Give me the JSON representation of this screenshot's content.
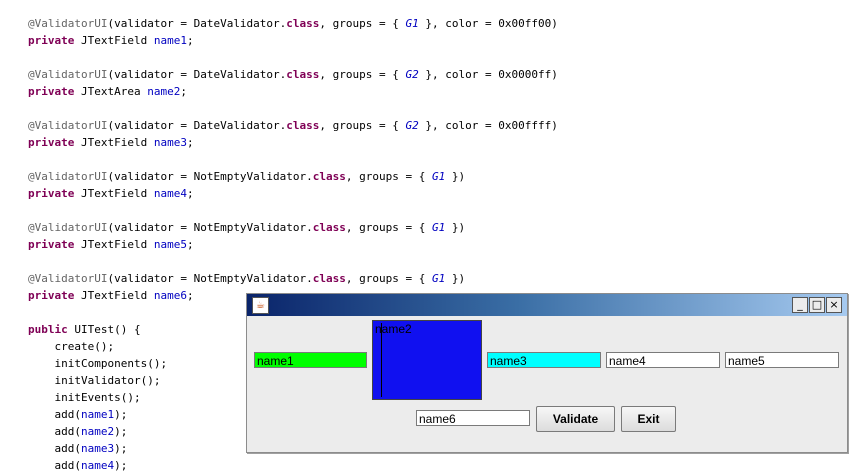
{
  "code_lines": [
    [
      {
        "t": "@ValidatorUI",
        "c": "ann"
      },
      {
        "t": "(validator = DateValidator."
      },
      {
        "t": "class",
        "c": "kw"
      },
      {
        "t": ", groups = { "
      },
      {
        "t": "G1",
        "c": "grp"
      },
      {
        "t": " }, color = 0x00ff00)"
      }
    ],
    [
      {
        "t": "private",
        "c": "kw"
      },
      {
        "t": " JTextField "
      },
      {
        "t": "name1",
        "c": "fld"
      },
      {
        "t": ";"
      }
    ],
    [],
    [
      {
        "t": "@ValidatorUI",
        "c": "ann"
      },
      {
        "t": "(validator = DateValidator."
      },
      {
        "t": "class",
        "c": "kw"
      },
      {
        "t": ", groups = { "
      },
      {
        "t": "G2",
        "c": "grp"
      },
      {
        "t": " }, color = 0x0000ff)"
      }
    ],
    [
      {
        "t": "private",
        "c": "kw"
      },
      {
        "t": " JTextArea "
      },
      {
        "t": "name2",
        "c": "fld"
      },
      {
        "t": ";"
      }
    ],
    [],
    [
      {
        "t": "@ValidatorUI",
        "c": "ann"
      },
      {
        "t": "(validator = DateValidator."
      },
      {
        "t": "class",
        "c": "kw"
      },
      {
        "t": ", groups = { "
      },
      {
        "t": "G2",
        "c": "grp"
      },
      {
        "t": " }, color = 0x00ffff)"
      }
    ],
    [
      {
        "t": "private",
        "c": "kw"
      },
      {
        "t": " JTextField "
      },
      {
        "t": "name3",
        "c": "fld"
      },
      {
        "t": ";"
      }
    ],
    [],
    [
      {
        "t": "@ValidatorUI",
        "c": "ann"
      },
      {
        "t": "(validator = NotEmptyValidator."
      },
      {
        "t": "class",
        "c": "kw"
      },
      {
        "t": ", groups = { "
      },
      {
        "t": "G1",
        "c": "grp"
      },
      {
        "t": " })"
      }
    ],
    [
      {
        "t": "private",
        "c": "kw"
      },
      {
        "t": " JTextField "
      },
      {
        "t": "name4",
        "c": "fld"
      },
      {
        "t": ";"
      }
    ],
    [],
    [
      {
        "t": "@ValidatorUI",
        "c": "ann"
      },
      {
        "t": "(validator = NotEmptyValidator."
      },
      {
        "t": "class",
        "c": "kw"
      },
      {
        "t": ", groups = { "
      },
      {
        "t": "G1",
        "c": "grp"
      },
      {
        "t": " })"
      }
    ],
    [
      {
        "t": "private",
        "c": "kw"
      },
      {
        "t": " JTextField "
      },
      {
        "t": "name5",
        "c": "fld"
      },
      {
        "t": ";"
      }
    ],
    [],
    [
      {
        "t": "@ValidatorUI",
        "c": "ann"
      },
      {
        "t": "(validator = NotEmptyValidator."
      },
      {
        "t": "class",
        "c": "kw"
      },
      {
        "t": ", groups = { "
      },
      {
        "t": "G1",
        "c": "grp"
      },
      {
        "t": " })"
      }
    ],
    [
      {
        "t": "private",
        "c": "kw"
      },
      {
        "t": " JTextField "
      },
      {
        "t": "name6",
        "c": "fld"
      },
      {
        "t": ";"
      }
    ],
    [],
    [
      {
        "t": "public",
        "c": "kw"
      },
      {
        "t": " UITest() {"
      }
    ],
    [
      {
        "t": "    create();"
      }
    ],
    [
      {
        "t": "    initComponents();"
      }
    ],
    [
      {
        "t": "    initValidator();"
      }
    ],
    [
      {
        "t": "    initEvents();"
      }
    ],
    [
      {
        "t": "    add("
      },
      {
        "t": "name1",
        "c": "fld"
      },
      {
        "t": ");"
      }
    ],
    [
      {
        "t": "    add("
      },
      {
        "t": "name2",
        "c": "fld"
      },
      {
        "t": ");"
      }
    ],
    [
      {
        "t": "    add("
      },
      {
        "t": "name3",
        "c": "fld"
      },
      {
        "t": ");"
      }
    ],
    [
      {
        "t": "    add("
      },
      {
        "t": "name4",
        "c": "fld"
      },
      {
        "t": ");"
      }
    ]
  ],
  "window": {
    "title": "",
    "icon": "java-cup-icon",
    "controls": {
      "minimize": "_",
      "maximize": "□",
      "close": "×"
    },
    "fields": {
      "name1": {
        "value": "name1",
        "bg": "#00ff00"
      },
      "name2": {
        "value": "name2",
        "bg": "#1010f0"
      },
      "name3": {
        "value": "name3",
        "bg": "#00ffff"
      },
      "name4": {
        "value": "name4",
        "bg": "#ffffff"
      },
      "name5": {
        "value": "name5",
        "bg": "#ffffff"
      },
      "name6": {
        "value": "name6",
        "bg": "#ffffff"
      }
    },
    "buttons": {
      "validate": "Validate",
      "exit": "Exit"
    }
  }
}
